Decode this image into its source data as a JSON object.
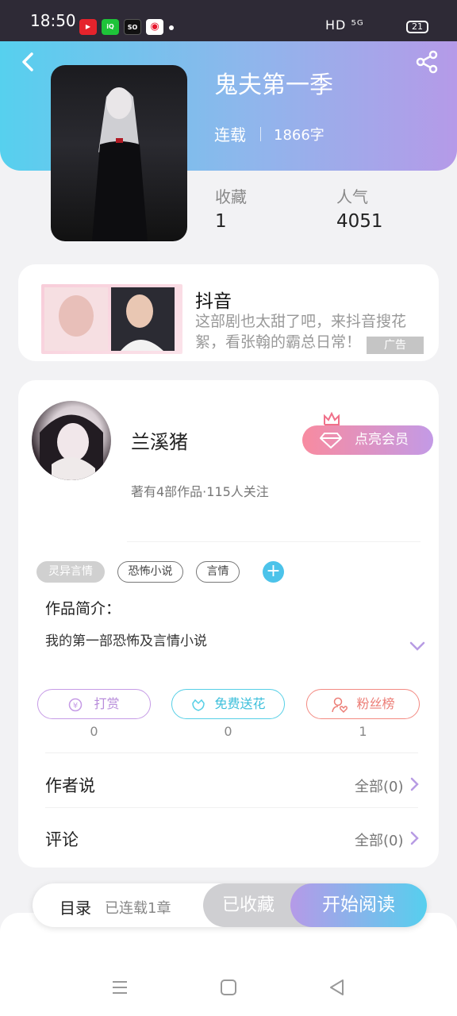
{
  "status_bar": {
    "time": "18:50",
    "apps": [
      "huawei-video-icon",
      "iqiyi-icon",
      "so-app-icon",
      "weibo-icon"
    ],
    "network": "HD ⁵ᴳ",
    "battery": "21"
  },
  "book": {
    "title": "鬼夫第一季",
    "status": "连载",
    "word_count": "1866字",
    "collect_label": "收藏",
    "collect_value": "1",
    "popularity_label": "人气",
    "popularity_value": "4051"
  },
  "ad": {
    "title": "抖音",
    "text": "这部剧也太甜了吧，来抖音搜花絮，看张翰的霸总日常！",
    "tag": "广告"
  },
  "author": {
    "name": "兰溪猪",
    "meta": "著有4部作品·115人关注",
    "vip_label": "点亮会员"
  },
  "tags": [
    "灵异言情",
    "恐怖小说",
    "言情"
  ],
  "intro": {
    "heading": "作品简介：",
    "text": "我的第一部恐怖及言情小说"
  },
  "actions": [
    {
      "label": "打赏",
      "count": "0"
    },
    {
      "label": "免费送花",
      "count": "0"
    },
    {
      "label": "粉丝榜",
      "count": "1"
    }
  ],
  "rows": [
    {
      "label": "作者说",
      "value": "全部(0)"
    },
    {
      "label": "评论",
      "value": "全部(0)"
    }
  ],
  "bottom_bar": {
    "toc_label": "目录",
    "toc_sub": "已连载1章",
    "collected_label": "已收藏",
    "read_label": "开始阅读"
  },
  "colors": {
    "header_gradient_start": "#56d0ee",
    "header_gradient_end": "#b59ae8",
    "accent_blue": "#4cc3ea",
    "accent_pink": "#f88ba0"
  }
}
